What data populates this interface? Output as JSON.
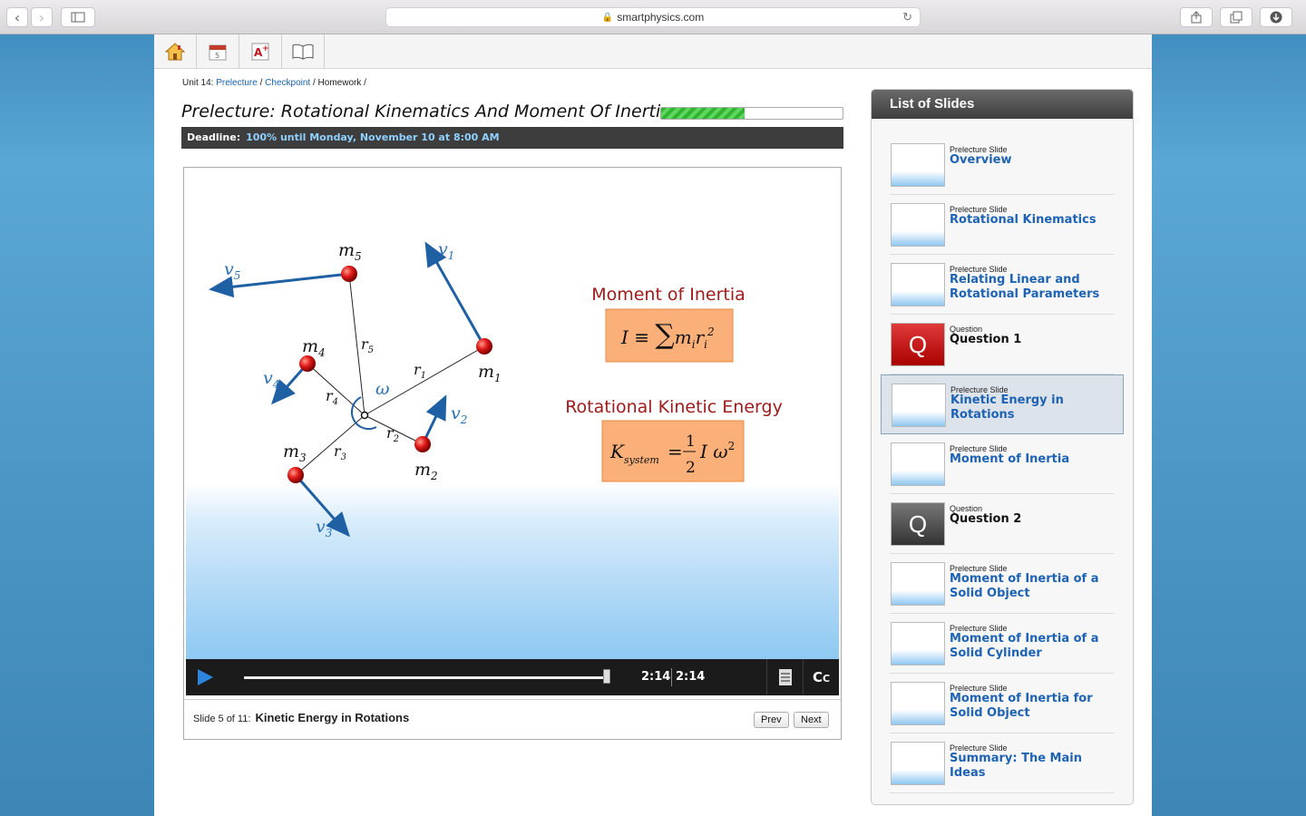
{
  "browser": {
    "url": "smartphysics.com"
  },
  "breadcrumb": {
    "prefix": "Unit 14:",
    "link1": "Prelecture",
    "link2": "Checkpoint",
    "current": "Homework",
    "sep": "/"
  },
  "page_title": "Prelecture: Rotational Kinematics And Moment Of Inertia",
  "progress_fraction": 0.46,
  "deadline": {
    "label": "Deadline:",
    "value": "100% until Monday, November 10 at 8:00 AM"
  },
  "slide": {
    "heading1": "Moment of Inertia",
    "heading2": "Rotational Kinetic Energy",
    "masses": [
      "m5",
      "m4",
      "m3",
      "m2",
      "m1"
    ]
  },
  "player": {
    "time_current": "2:14",
    "time_total": "2:14"
  },
  "footer": {
    "slide_position": "Slide 5 of 11:",
    "slide_name": "Kinetic Energy in Rotations",
    "prev": "Prev",
    "next": "Next"
  },
  "list": {
    "title": "List of Slides",
    "items": [
      {
        "type": "Prelecture Slide",
        "name": "Overview"
      },
      {
        "type": "Prelecture Slide",
        "name": "Rotational Kinematics"
      },
      {
        "type": "Prelecture Slide",
        "name": "Relating Linear and Rotational Parameters"
      },
      {
        "type": "Question",
        "name": "Question 1"
      },
      {
        "type": "Prelecture Slide",
        "name": "Kinetic Energy in Rotations"
      },
      {
        "type": "Prelecture Slide",
        "name": "Moment of Inertia"
      },
      {
        "type": "Question",
        "name": "Question 2"
      },
      {
        "type": "Prelecture Slide",
        "name": "Moment of Inertia of a Solid Object"
      },
      {
        "type": "Prelecture Slide",
        "name": "Moment of Inertia of a Solid Cylinder"
      },
      {
        "type": "Prelecture Slide",
        "name": "Moment of Inertia for Solid Object"
      },
      {
        "type": "Prelecture Slide",
        "name": "Summary: The Main Ideas"
      }
    ]
  },
  "colors": {
    "link": "#1a63b0",
    "slide_heading": "#a01b1b",
    "formula_box": "#fbb07a",
    "progress": "#2fb52f"
  }
}
